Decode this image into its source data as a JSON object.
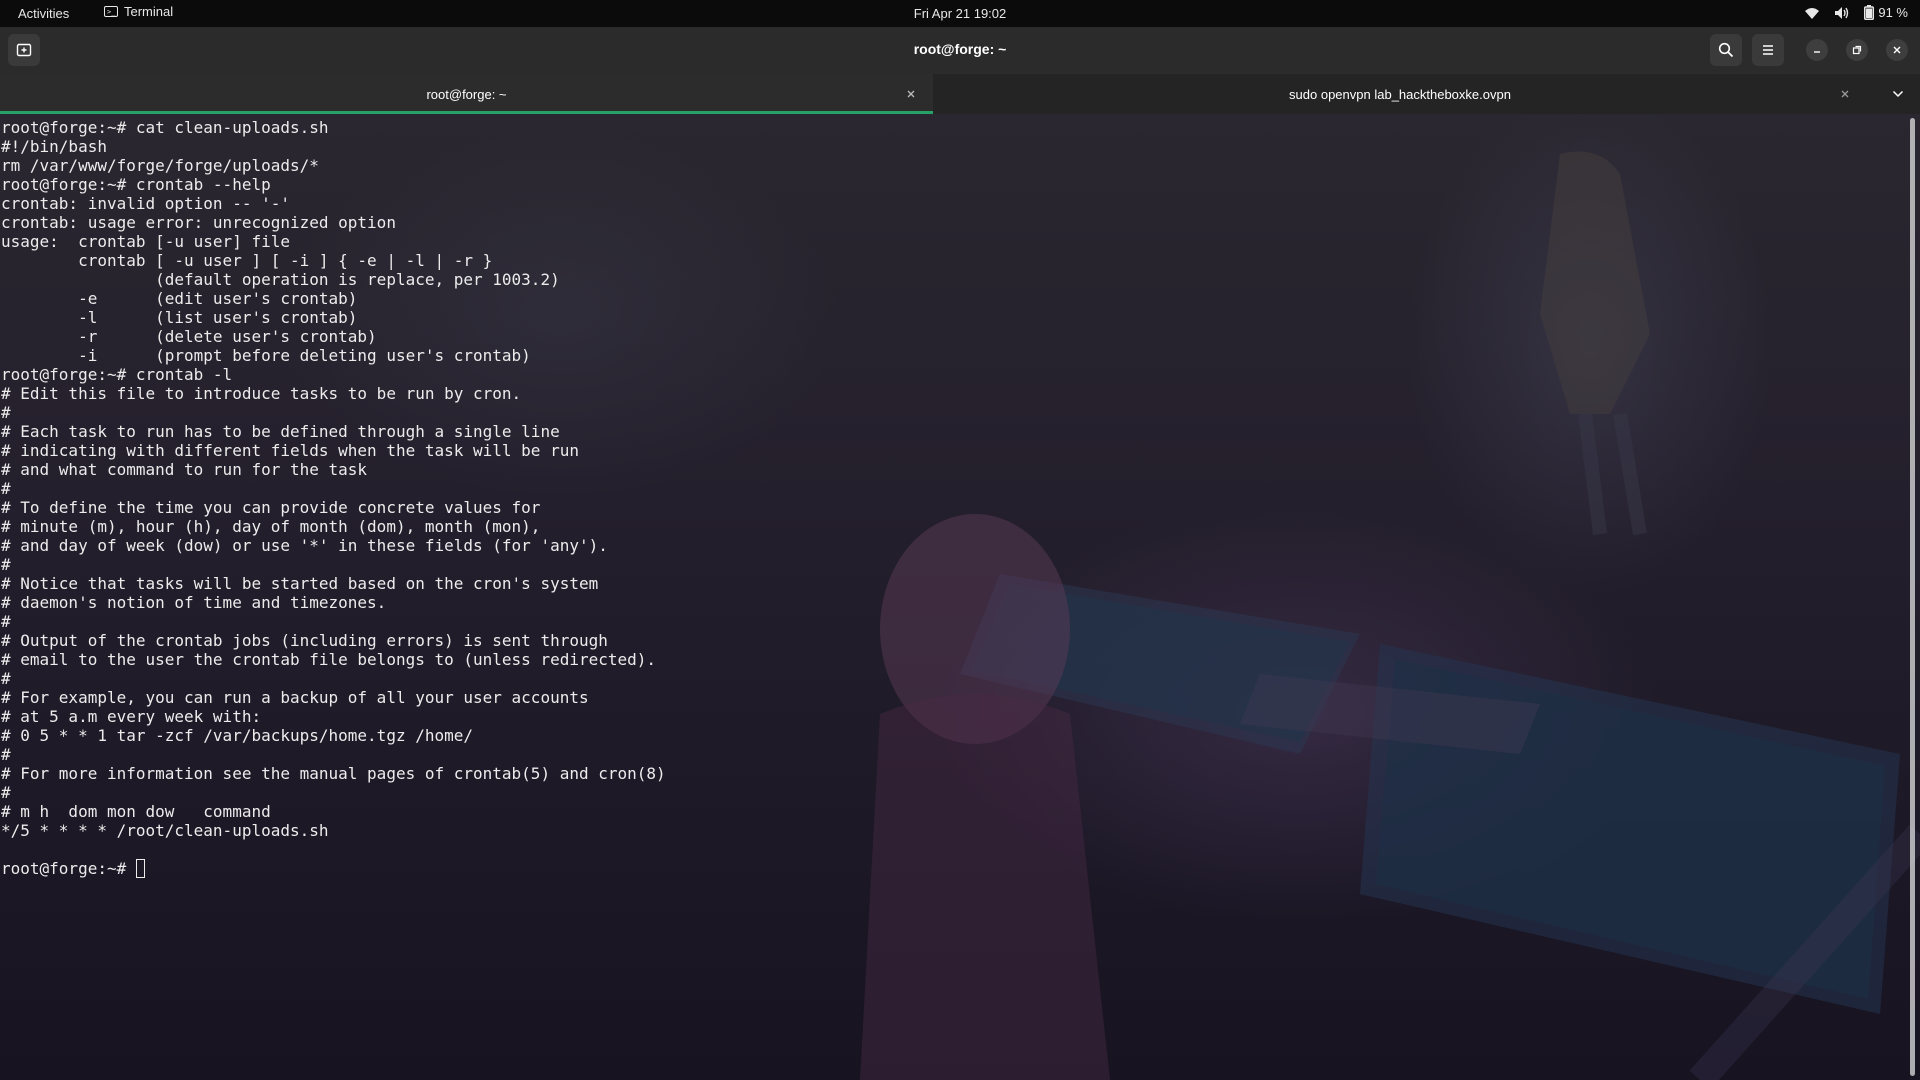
{
  "topbar": {
    "activities": "Activities",
    "app_name": "Terminal",
    "app_icon": "terminal-icon",
    "clock": "Fri Apr 21  19:02",
    "battery_percent": "91 %",
    "tray_icons": [
      "wifi-icon",
      "volume-icon",
      "battery-icon"
    ]
  },
  "window": {
    "title": "root@forge: ~",
    "buttons": {
      "new_tab_icon": "new-tab-icon",
      "search_icon": "search-icon",
      "menu_icon": "hamburger-menu-icon",
      "minimize_icon": "minimize-icon",
      "maximize_icon": "maximize-icon",
      "close_icon": "close-icon"
    }
  },
  "tabs": [
    {
      "label": "root@forge: ~",
      "active": true
    },
    {
      "label": "sudo openvpn lab_hacktheboxke.ovpn",
      "active": false
    }
  ],
  "colors": {
    "accent": "#26a269",
    "terminal_fg": "#ececec",
    "headerbar_bg": "#2b2b2b",
    "topbar_bg": "#0b0b0b"
  },
  "terminal": {
    "lines": [
      "root@forge:~# cat clean-uploads.sh",
      "#!/bin/bash",
      "rm /var/www/forge/forge/uploads/*",
      "root@forge:~# crontab --help",
      "crontab: invalid option -- '-'",
      "crontab: usage error: unrecognized option",
      "usage:  crontab [-u user] file",
      "        crontab [ -u user ] [ -i ] { -e | -l | -r }",
      "                (default operation is replace, per 1003.2)",
      "        -e      (edit user's crontab)",
      "        -l      (list user's crontab)",
      "        -r      (delete user's crontab)",
      "        -i      (prompt before deleting user's crontab)",
      "root@forge:~# crontab -l",
      "# Edit this file to introduce tasks to be run by cron.",
      "#",
      "# Each task to run has to be defined through a single line",
      "# indicating with different fields when the task will be run",
      "# and what command to run for the task",
      "#",
      "# To define the time you can provide concrete values for",
      "# minute (m), hour (h), day of month (dom), month (mon),",
      "# and day of week (dow) or use '*' in these fields (for 'any').",
      "#",
      "# Notice that tasks will be started based on the cron's system",
      "# daemon's notion of time and timezones.",
      "#",
      "# Output of the crontab jobs (including errors) is sent through",
      "# email to the user the crontab file belongs to (unless redirected).",
      "#",
      "# For example, you can run a backup of all your user accounts",
      "# at 5 a.m every week with:",
      "# 0 5 * * 1 tar -zcf /var/backups/home.tgz /home/",
      "#",
      "# For more information see the manual pages of crontab(5) and cron(8)",
      "#",
      "# m h  dom mon dow   command",
      "*/5 * * * * /root/clean-uploads.sh",
      ""
    ],
    "prompt": "root@forge:~# "
  }
}
